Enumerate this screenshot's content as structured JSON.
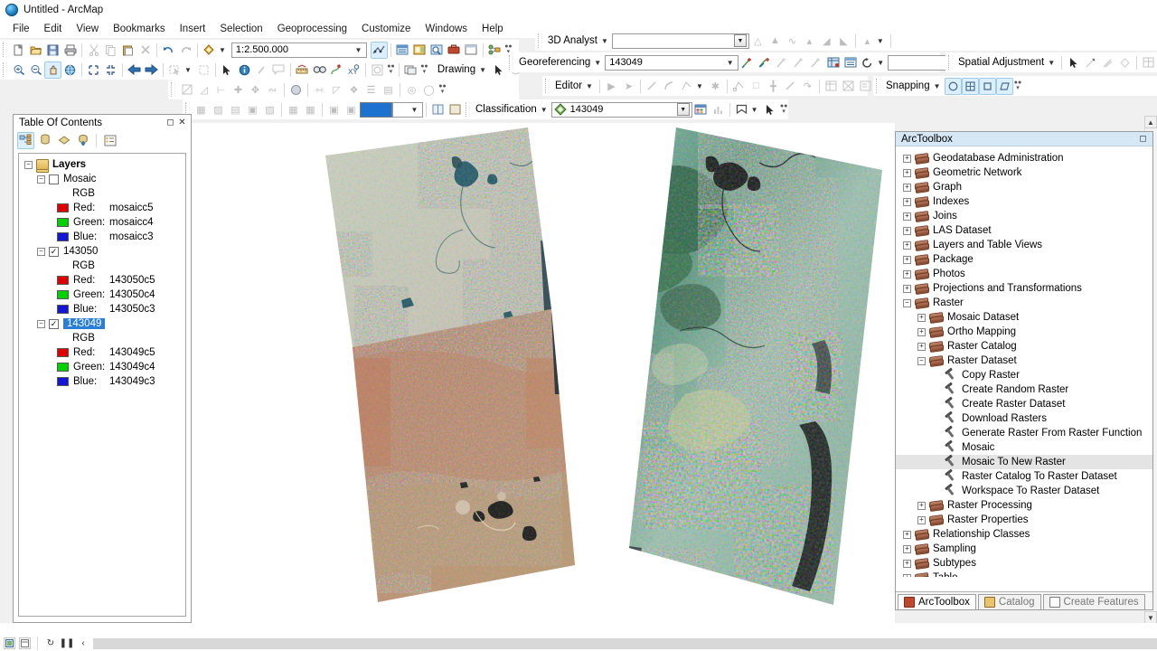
{
  "window": {
    "title": "Untitled - ArcMap",
    "app_icon": "arcmap-globe-icon"
  },
  "menu": {
    "items": [
      "File",
      "Edit",
      "View",
      "Bookmarks",
      "Insert",
      "Selection",
      "Geoprocessing",
      "Customize",
      "Windows",
      "Help"
    ]
  },
  "standard_toolbar": {
    "scale_value": "1:2.500.000",
    "buttons": [
      {
        "name": "new-map-button",
        "glyph": "὜B"
      },
      {
        "name": "open-button",
        "glyph": ""
      },
      {
        "name": "save-button",
        "glyph": ""
      },
      {
        "name": "print-button",
        "glyph": ""
      },
      {
        "name": "cut-button",
        "glyph": "✂"
      },
      {
        "name": "copy-button",
        "glyph": ""
      },
      {
        "name": "paste-button",
        "glyph": ""
      },
      {
        "name": "delete-button",
        "glyph": "×"
      },
      {
        "name": "undo-button",
        "glyph": "↶"
      },
      {
        "name": "redo-button",
        "glyph": "↷"
      },
      {
        "name": "add-data-button",
        "glyph": "✦"
      },
      {
        "name": "scale-combo",
        "glyph": ""
      },
      {
        "name": "editor-toolbar-button",
        "glyph": ""
      },
      {
        "name": "table-of-contents-button",
        "glyph": ""
      },
      {
        "name": "catalog-window-button",
        "glyph": ""
      },
      {
        "name": "search-window-button",
        "glyph": ""
      },
      {
        "name": "arctoolbox-window-button",
        "glyph": ""
      },
      {
        "name": "python-window-button",
        "glyph": ""
      },
      {
        "name": "model-builder-button",
        "glyph": ""
      }
    ]
  },
  "tools_toolbar": {
    "drawing_label": "Drawing",
    "buttons": [
      {
        "name": "zoom-in-tool",
        "glyph": "⊕"
      },
      {
        "name": "zoom-out-tool",
        "glyph": "⊖"
      },
      {
        "name": "pan-tool",
        "glyph": "✋",
        "active": true
      },
      {
        "name": "full-extent-tool",
        "glyph": "◉"
      },
      {
        "name": "fixed-zoom-in-tool",
        "glyph": ""
      },
      {
        "name": "fixed-zoom-out-tool",
        "glyph": ""
      },
      {
        "name": "go-back-extent-tool",
        "glyph": "←"
      },
      {
        "name": "go-forward-extent-tool",
        "glyph": "→"
      },
      {
        "name": "select-features-tool",
        "glyph": ""
      },
      {
        "name": "clear-selection-tool",
        "glyph": ""
      },
      {
        "name": "select-elements-tool",
        "glyph": "➤"
      },
      {
        "name": "identify-tool",
        "glyph": "i"
      },
      {
        "name": "hyperlink-tool",
        "glyph": "⁄"
      },
      {
        "name": "html-popup-tool",
        "glyph": ""
      },
      {
        "name": "measure-tool",
        "glyph": ""
      },
      {
        "name": "find-tool",
        "glyph": "ὐD"
      },
      {
        "name": "find-route-tool",
        "glyph": ""
      },
      {
        "name": "go-to-xy-tool",
        "glyph": "XY"
      },
      {
        "name": "time-slider-tool",
        "glyph": ""
      },
      {
        "name": "create-viewer-window-tool",
        "glyph": ""
      }
    ]
  },
  "georeferencing_toolbar": {
    "label": "Georeferencing",
    "layer_value": "143049"
  },
  "analyst_3d_toolbar": {
    "label": "3D Analyst",
    "layer_value": ""
  },
  "editor_toolbar": {
    "label": "Editor"
  },
  "spatial_adjustment_toolbar": {
    "label": "Spatial Adjustment"
  },
  "snapping_toolbar": {
    "label": "Snapping"
  },
  "classification_toolbar": {
    "label": "Classification",
    "layer_value": "143049"
  },
  "effects_toolbar": {
    "swatch_color": "#1d72d0"
  },
  "table_of_contents": {
    "title": "Table Of Contents",
    "tools": [
      {
        "name": "list-by-drawing-order-button",
        "active": true
      },
      {
        "name": "list-by-source-button",
        "active": false
      },
      {
        "name": "list-by-visibility-button",
        "active": false
      },
      {
        "name": "list-by-selection-button",
        "active": false
      },
      {
        "name": "options-button",
        "active": false
      }
    ],
    "root": "Layers",
    "layers": [
      {
        "name": "Mosaic",
        "checked": false,
        "selected": false,
        "renderer": "RGB",
        "bands": [
          {
            "label": "Red:",
            "value": "mosaicc5",
            "color": "#e00000"
          },
          {
            "label": "Green:",
            "value": "mosaicc4",
            "color": "#00d200"
          },
          {
            "label": "Blue:",
            "value": "mosaicc3",
            "color": "#1515d8"
          }
        ]
      },
      {
        "name": "143050",
        "checked": true,
        "selected": false,
        "renderer": "RGB",
        "bands": [
          {
            "label": "Red:",
            "value": "143050c5",
            "color": "#e00000"
          },
          {
            "label": "Green:",
            "value": "143050c4",
            "color": "#00d200"
          },
          {
            "label": "Blue:",
            "value": "143050c3",
            "color": "#1515d8"
          }
        ]
      },
      {
        "name": "143049",
        "checked": true,
        "selected": true,
        "renderer": "RGB",
        "bands": [
          {
            "label": "Red:",
            "value": "143049c5",
            "color": "#e00000"
          },
          {
            "label": "Green:",
            "value": "143049c4",
            "color": "#00d200"
          },
          {
            "label": "Blue:",
            "value": "143049c3",
            "color": "#1515d8"
          }
        ]
      }
    ]
  },
  "arctoolbox": {
    "title": "ArcToolbox",
    "nodes": [
      {
        "label": "Geodatabase Administration",
        "level": 0,
        "type": "toolbox",
        "expander": "+"
      },
      {
        "label": "Geometric Network",
        "level": 0,
        "type": "toolbox",
        "expander": "+"
      },
      {
        "label": "Graph",
        "level": 0,
        "type": "toolbox",
        "expander": "+"
      },
      {
        "label": "Indexes",
        "level": 0,
        "type": "toolbox",
        "expander": "+"
      },
      {
        "label": "Joins",
        "level": 0,
        "type": "toolbox",
        "expander": "+"
      },
      {
        "label": "LAS Dataset",
        "level": 0,
        "type": "toolbox",
        "expander": "+"
      },
      {
        "label": "Layers and Table Views",
        "level": 0,
        "type": "toolbox",
        "expander": "+"
      },
      {
        "label": "Package",
        "level": 0,
        "type": "toolbox",
        "expander": "+"
      },
      {
        "label": "Photos",
        "level": 0,
        "type": "toolbox",
        "expander": "+"
      },
      {
        "label": "Projections and Transformations",
        "level": 0,
        "type": "toolbox",
        "expander": "+"
      },
      {
        "label": "Raster",
        "level": 0,
        "type": "toolbox",
        "expander": "-"
      },
      {
        "label": "Mosaic Dataset",
        "level": 1,
        "type": "toolbox",
        "expander": "+"
      },
      {
        "label": "Ortho Mapping",
        "level": 1,
        "type": "toolbox",
        "expander": "+"
      },
      {
        "label": "Raster Catalog",
        "level": 1,
        "type": "toolbox",
        "expander": "+"
      },
      {
        "label": "Raster Dataset",
        "level": 1,
        "type": "toolbox",
        "expander": "-"
      },
      {
        "label": "Copy Raster",
        "level": 2,
        "type": "tool",
        "expander": ""
      },
      {
        "label": "Create Random Raster",
        "level": 2,
        "type": "tool",
        "expander": ""
      },
      {
        "label": "Create Raster Dataset",
        "level": 2,
        "type": "tool",
        "expander": ""
      },
      {
        "label": "Download Rasters",
        "level": 2,
        "type": "tool",
        "expander": ""
      },
      {
        "label": "Generate Raster From Raster Function",
        "level": 2,
        "type": "tool",
        "expander": ""
      },
      {
        "label": "Mosaic",
        "level": 2,
        "type": "tool",
        "expander": ""
      },
      {
        "label": "Mosaic To New Raster",
        "level": 2,
        "type": "tool",
        "expander": "",
        "highlighted": true
      },
      {
        "label": "Raster Catalog To Raster Dataset",
        "level": 2,
        "type": "tool",
        "expander": ""
      },
      {
        "label": "Workspace To Raster Dataset",
        "level": 2,
        "type": "tool",
        "expander": ""
      },
      {
        "label": "Raster Processing",
        "level": 1,
        "type": "toolbox",
        "expander": "+"
      },
      {
        "label": "Raster Properties",
        "level": 1,
        "type": "toolbox",
        "expander": "+"
      },
      {
        "label": "Relationship Classes",
        "level": 0,
        "type": "toolbox",
        "expander": "+"
      },
      {
        "label": "Sampling",
        "level": 0,
        "type": "toolbox",
        "expander": "+"
      },
      {
        "label": "Subtypes",
        "level": 0,
        "type": "toolbox",
        "expander": "+"
      },
      {
        "label": "Table",
        "level": 0,
        "type": "toolbox",
        "expander": "+"
      }
    ],
    "tabs": [
      {
        "label": "ArcToolbox",
        "active": true
      },
      {
        "label": "Catalog",
        "active": false
      },
      {
        "label": "Create Features",
        "active": false
      }
    ]
  },
  "map": {
    "rasters": [
      {
        "name": "raster-143050",
        "label": "143050"
      },
      {
        "name": "raster-143049",
        "label": "143049"
      },
      {
        "name": "raster-mosaic-right",
        "label": "mosaic"
      }
    ]
  },
  "taskbar": {
    "buttons": [
      {
        "name": "document-button-1",
        "glyph": "▣"
      },
      {
        "name": "document-button-2",
        "glyph": "□"
      },
      {
        "name": "refresh-button",
        "glyph": "↻"
      },
      {
        "name": "pause-button",
        "glyph": "❚❚"
      },
      {
        "name": "collapse-button",
        "glyph": "‹"
      }
    ]
  }
}
